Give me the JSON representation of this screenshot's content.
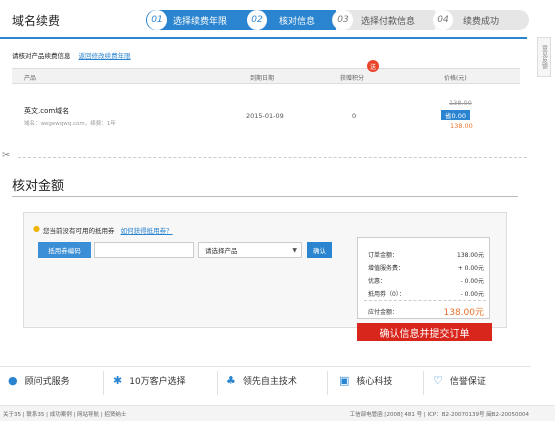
{
  "page_title": "域名续费",
  "steps": [
    {
      "num": "01",
      "label": "选择续费年限"
    },
    {
      "num": "02",
      "label": "核对信息"
    },
    {
      "num": "03",
      "label": "选择付款信息"
    },
    {
      "num": "04",
      "label": "续费成功"
    }
  ],
  "side_tab": "意见反馈",
  "confirm": {
    "heading": "请核对产品续费信息",
    "back_link": "返回修改续费年限"
  },
  "table": {
    "columns": [
      "产品",
      "到期日期",
      "获赠积分",
      "价格(元)"
    ],
    "badge": "送",
    "row": {
      "name": "英文.com域名",
      "sub": "域名：wegewqwq.com，续费：1年",
      "date": "2015-01-09",
      "points": "0",
      "price_old": "138.00",
      "discount": "省0.00",
      "price_new": "138.00"
    }
  },
  "section": {
    "title": "核对金额"
  },
  "coupon": {
    "tip": "您当前没有可用的抵用券",
    "tip_link": "如何获得抵用券？",
    "button": "抵用券编码",
    "input_value": "",
    "select_value": "请选择产品",
    "ok": "确认"
  },
  "summary": {
    "rows": [
      {
        "label": "订单金额：",
        "value": "138.00元"
      },
      {
        "label": "增值服务费：",
        "value": "+ 0.00元"
      },
      {
        "label": "优惠：",
        "value": "- 0.00元"
      },
      {
        "label": "抵用券（0）：",
        "value": "- 0.00元"
      }
    ],
    "total_label": "应付金额：",
    "total_value": "138.00元"
  },
  "submit": "确认信息并提交订单",
  "features": [
    "顾问式服务",
    "10万客户选择",
    "领先自主技术",
    "核心科技",
    "信誉保证"
  ],
  "footer": {
    "left": "关于35 | 联系35 | 成功案例 | 网站导航 | 招贤纳士",
    "right": "工信部电管函 [2008] 481 号 | ICP：B2-20070139号 闽B2-20050004"
  },
  "colors": {
    "accent": "#2a84cf",
    "submit": "#d8261c",
    "price_new": "#e8722b"
  }
}
